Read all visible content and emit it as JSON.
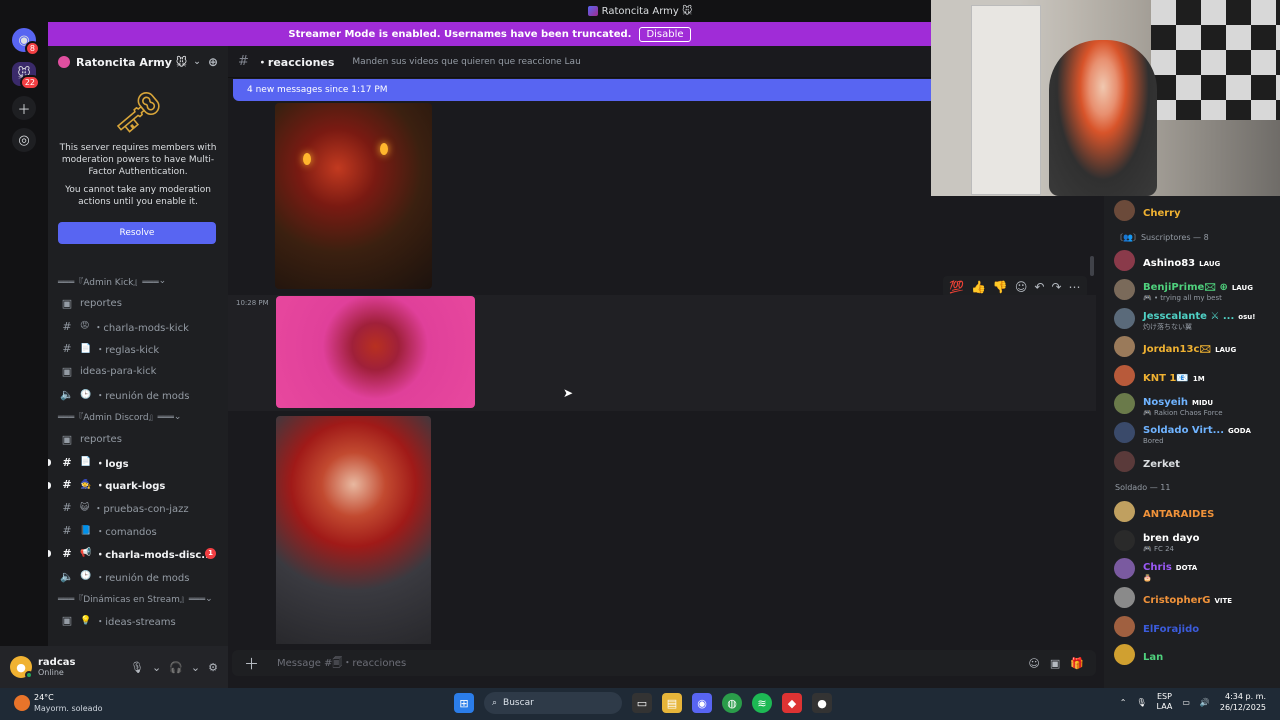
{
  "window": {
    "title": "Ratoncita Army 🐭"
  },
  "rail": {
    "dm_badge": "8",
    "server_badge": "22"
  },
  "banner": {
    "text": "Streamer Mode is enabled. Usernames have been truncated.",
    "button": "Disable"
  },
  "server": {
    "name": "Ratoncita Army 🐭"
  },
  "mfa": {
    "line1": "This server requires members with moderation powers to have Multi-Factor Authentication.",
    "line2": "You cannot take any moderation actions until you enable it.",
    "button": "Resolve"
  },
  "channels": [
    {
      "type": "category",
      "label": "═══『Admin Kick』═══"
    },
    {
      "type": "forum",
      "label": "reportes"
    },
    {
      "type": "text",
      "emoji": "😡",
      "label": "・charla-mods-kick"
    },
    {
      "type": "text",
      "emoji": "📄",
      "label": "・reglas-kick"
    },
    {
      "type": "forum",
      "label": "ideas-para-kick"
    },
    {
      "type": "voice",
      "emoji": "🕒",
      "label": "・reunión de mods"
    },
    {
      "type": "category",
      "label": "═══『Admin Discord』═══"
    },
    {
      "type": "forum",
      "label": "reportes"
    },
    {
      "type": "text",
      "emoji": "📄",
      "label": "・logs",
      "unread": true
    },
    {
      "type": "text",
      "emoji": "🧙",
      "label": "・quark-logs",
      "unread": true
    },
    {
      "type": "text",
      "emoji": "😺",
      "label": "・pruebas-con-jazz"
    },
    {
      "type": "text",
      "emoji": "📘",
      "label": "・comandos"
    },
    {
      "type": "text",
      "emoji": "📢",
      "label": "・charla-mods-disc...",
      "unread": true,
      "badge": "1"
    },
    {
      "type": "voice",
      "emoji": "🕒",
      "label": "・reunión de mods"
    },
    {
      "type": "category",
      "label": "═══『Dinámicas en Stream』═══"
    },
    {
      "type": "forum",
      "emoji": "💡",
      "label": "・ideas-streams"
    }
  ],
  "user": {
    "name": "radcas",
    "status": "Online"
  },
  "channel": {
    "name": "・reacciones",
    "topic": "Manden sus videos que quieren que reaccione Lau"
  },
  "chat": {
    "new_messages": "4 new messages since 1:17 PM",
    "timestamp": "10:28 PM"
  },
  "composer": {
    "placeholder": "Message #🗐・reacciones"
  },
  "members": [
    {
      "kind": "member",
      "name": "Cherry",
      "color": "#f0b232"
    },
    {
      "kind": "group",
      "label": "〔👥〕Suscriptores — 8"
    },
    {
      "kind": "member",
      "name": "Ashino83",
      "tag": "LAUG",
      "color": "#ffffff"
    },
    {
      "kind": "member",
      "name": "BenjiPrime🖂 ⊕",
      "tag": "LAUG",
      "sub": "🎮 • trying all my best",
      "color": "#4fd17d"
    },
    {
      "kind": "member",
      "name": "Jesscalante ⚔ ...",
      "tag": "osu!",
      "sub": "灼け落ちない翼",
      "color": "#4fd1c5"
    },
    {
      "kind": "member",
      "name": "Jordan13c🖂",
      "tag": "LAUG",
      "color": "#f0b232"
    },
    {
      "kind": "member",
      "name": "KNT 1📧",
      "tag": "1M",
      "color": "#f0b232"
    },
    {
      "kind": "member",
      "name": "Nosyeih",
      "tag": "MIDU",
      "sub": "🎮 Rakion Chaos Force",
      "color": "#6fb3ff"
    },
    {
      "kind": "member",
      "name": "Soldado Virt...",
      "tag": "GODA",
      "sub": "Bored",
      "color": "#6fb3ff"
    },
    {
      "kind": "member",
      "name": "Zerket",
      "color": "#dbdee1"
    },
    {
      "kind": "group",
      "label": "Soldado — 11"
    },
    {
      "kind": "member",
      "name": "ANTARAIDES",
      "color": "#f0923a"
    },
    {
      "kind": "member",
      "name": "bren dayo",
      "sub": "🎮 FC 24",
      "color": "#ffffff"
    },
    {
      "kind": "member",
      "name": "Chris",
      "tag": "DOTA",
      "sub": "🎂",
      "color": "#9b59f6"
    },
    {
      "kind": "member",
      "name": "CristopherG",
      "tag": "VITE",
      "color": "#f0923a"
    },
    {
      "kind": "member",
      "name": "ElForajido",
      "color": "#3b5bdb"
    },
    {
      "kind": "member",
      "name": "Lan",
      "color": "#4fd17d"
    }
  ],
  "taskbar": {
    "temp": "24°C",
    "weather": "Mayorm. soleado",
    "search": "Buscar",
    "lang1": "ESP",
    "lang2": "LAA",
    "time": "4:34 p. m.",
    "date": "26/12/2025"
  }
}
